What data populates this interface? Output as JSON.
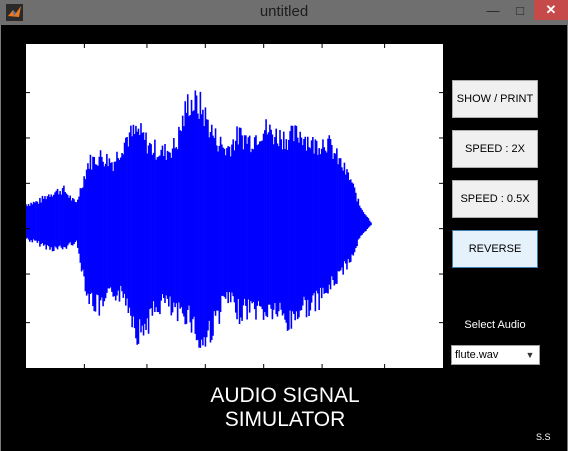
{
  "window": {
    "title": "untitled",
    "icon": "matlab-logo-icon",
    "controls": [
      "minimize-icon",
      "maximize-icon",
      "close-icon"
    ]
  },
  "buttons": {
    "show_print": "SHOW / PRINT",
    "speed_2x": "SPEED : 2X",
    "speed_half": "SPEED : 0.5X",
    "reverse": "REVERSE"
  },
  "audio_select": {
    "label": "Select Audio",
    "selected": "flute.wav"
  },
  "heading": {
    "line1": "AUDIO SIGNAL",
    "line2": "SIMULATOR"
  },
  "credit": "S.S",
  "chart_data": {
    "type": "line",
    "title": "",
    "xlabel": "",
    "ylabel": "",
    "xticklabels": [],
    "yticklabels": [],
    "series_color": "#0000ff",
    "axes_background": "#ffffff",
    "envelope": {
      "t": [
        0,
        0.03,
        0.06,
        0.09,
        0.12,
        0.15,
        0.18,
        0.21,
        0.24,
        0.27,
        0.3,
        0.33,
        0.36,
        0.39,
        0.42,
        0.45,
        0.48,
        0.51,
        0.54,
        0.57,
        0.6,
        0.63,
        0.66,
        0.69,
        0.72,
        0.75,
        0.78,
        0.8,
        0.83,
        0.86,
        0.9,
        1.0
      ],
      "upper": [
        0.16,
        0.18,
        0.25,
        0.28,
        0.16,
        0.5,
        0.55,
        0.5,
        0.7,
        0.75,
        0.62,
        0.58,
        0.64,
        1.0,
        0.95,
        0.72,
        0.6,
        0.72,
        0.68,
        0.78,
        0.72,
        0.7,
        0.74,
        0.64,
        0.68,
        0.52,
        0.35,
        0.15,
        0.0,
        0.0,
        0.0,
        0.0
      ],
      "lower": [
        0.12,
        0.16,
        0.2,
        0.2,
        0.14,
        0.6,
        0.7,
        0.55,
        0.6,
        0.9,
        0.76,
        0.62,
        0.75,
        0.72,
        1.0,
        0.82,
        0.6,
        0.72,
        0.68,
        0.72,
        0.7,
        0.82,
        0.68,
        0.66,
        0.56,
        0.42,
        0.28,
        0.12,
        0.0,
        0.0,
        0.0,
        0.0
      ]
    }
  }
}
